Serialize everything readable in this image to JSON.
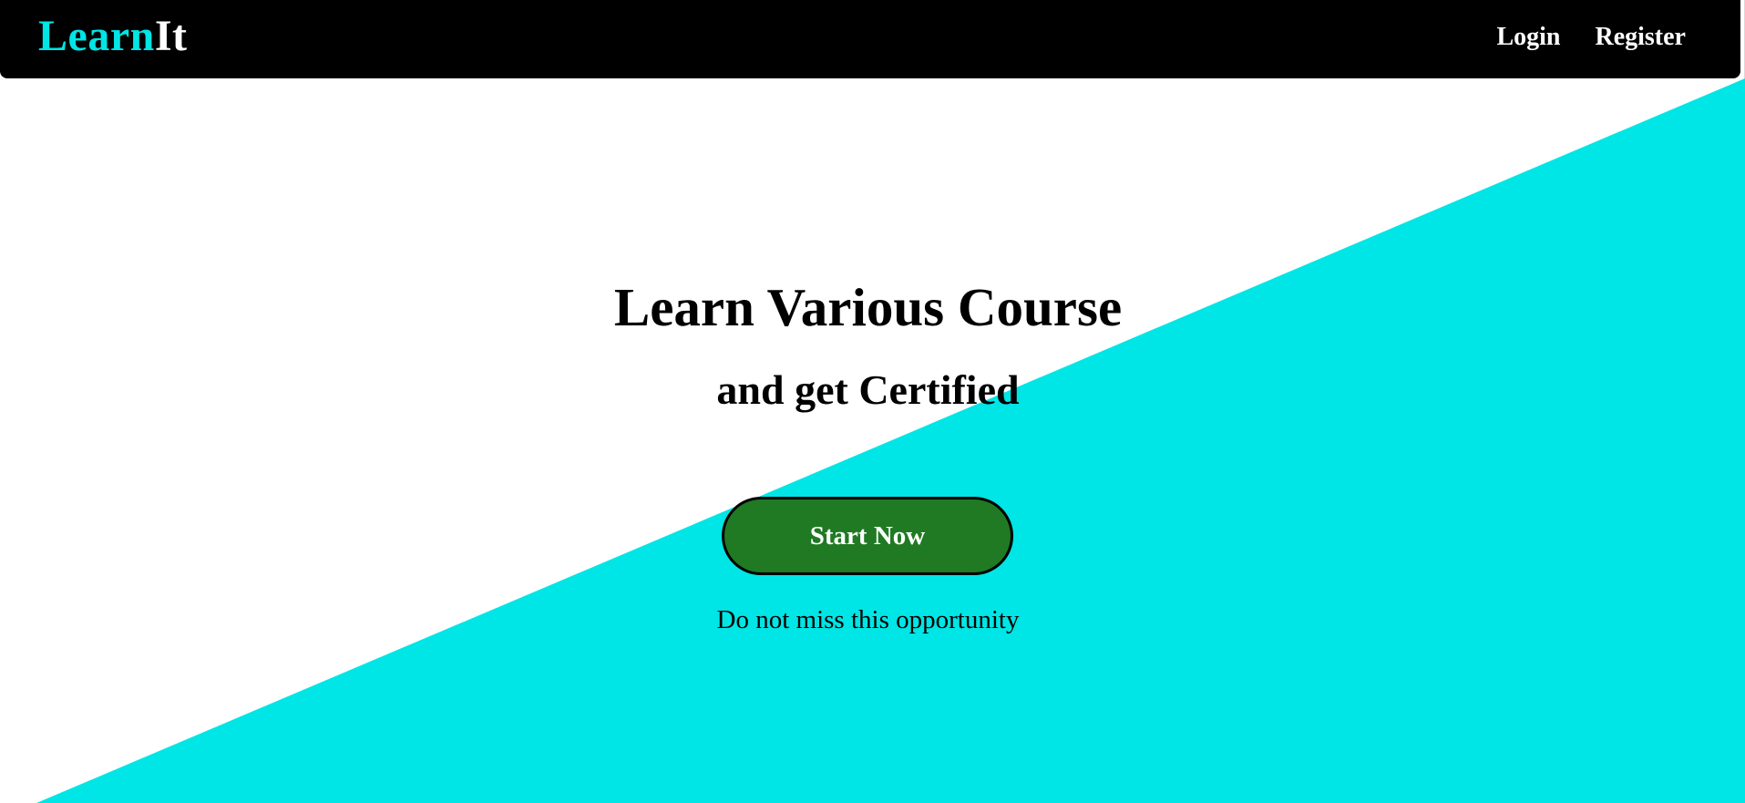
{
  "navbar": {
    "logo_part1": "Learn",
    "logo_part2": "It",
    "login_label": "Login",
    "register_label": "Register"
  },
  "hero": {
    "title": "Learn Various Course",
    "subtitle": "and get Certified",
    "cta_label": "Start Now",
    "note": "Do not miss this opportunity"
  },
  "colors": {
    "accent": "#00e5e5",
    "navbar_bg": "#000000",
    "button_bg": "#1f7a23",
    "button_text": "#ffffff"
  }
}
